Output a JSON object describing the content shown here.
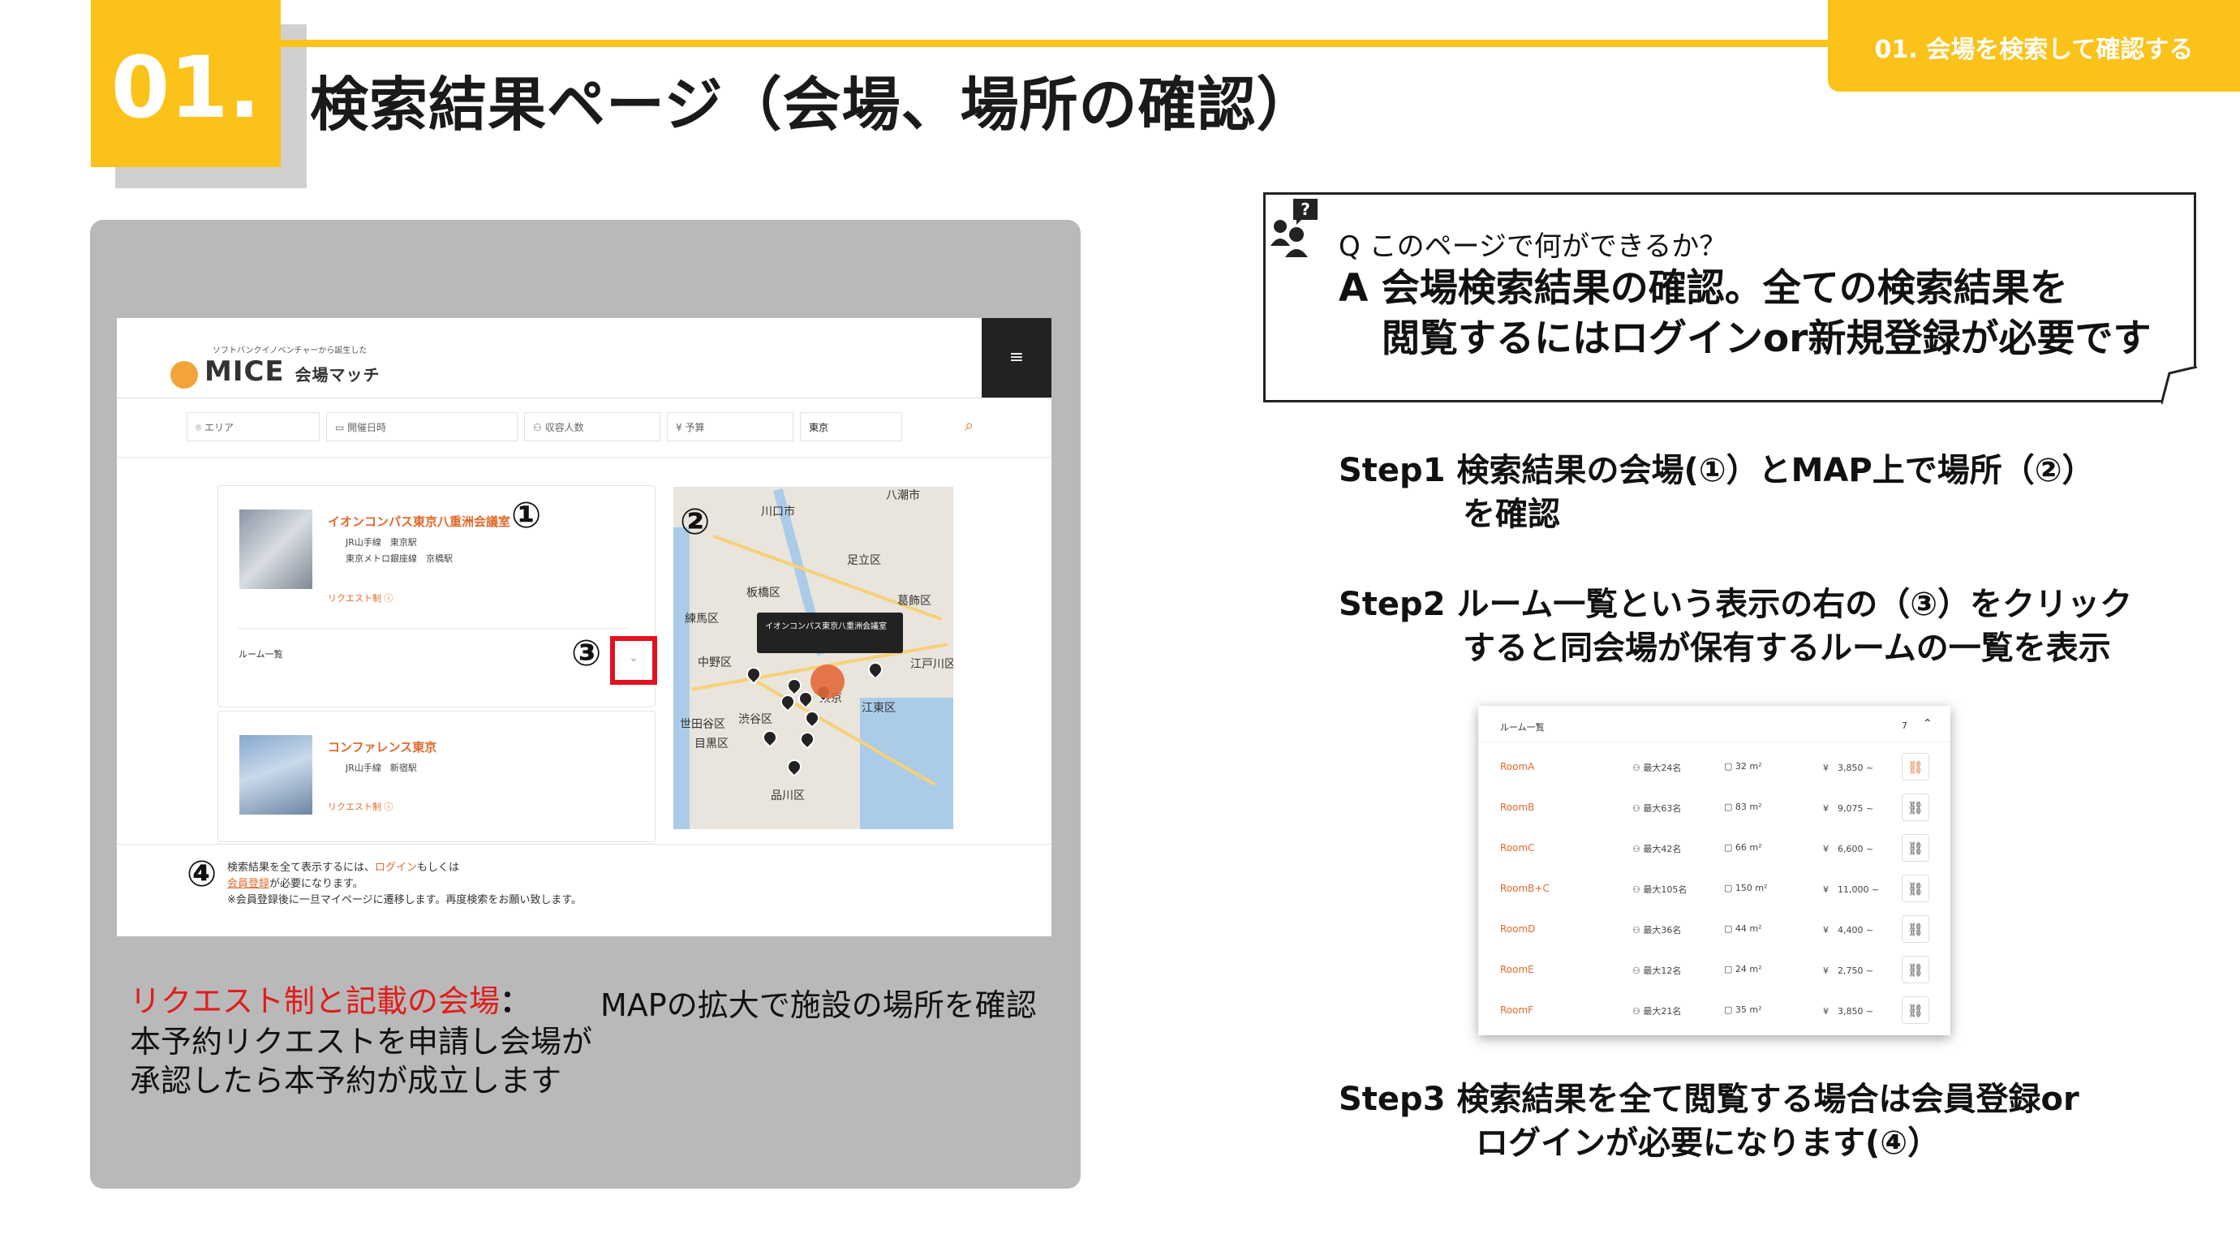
{
  "header": {
    "number": "01.",
    "title": "検索結果ページ（会場、場所の確認）",
    "section_tag": "01. 会場を検索して確認する"
  },
  "screenshot": {
    "logo_tagline": "ソフトバンクイノベンチャーから誕生した",
    "logo_main": "MICE",
    "logo_sub": "会場マッチ",
    "menu_icon": "≡",
    "search_fields": [
      "エリア",
      "開催日時",
      "収容人数",
      "予算",
      "東京"
    ],
    "venues": [
      {
        "name": "イオンコンパス東京八重洲会議室",
        "line1": "JR山手線　東京駅",
        "line2": "東京メトロ銀座線　京橋駅",
        "request": "リクエスト制"
      },
      {
        "name": "コンファレンス東京",
        "line1": "JR山手線　新宿駅",
        "line2": "",
        "request": "リクエスト制"
      }
    ],
    "room_list_label": "ルーム一覧",
    "map_tooltip": "イオンコンパス東京八重洲会議室",
    "map_labels": [
      "川口市",
      "八潮市",
      "足立区",
      "板橋区",
      "葛飾区",
      "練馬区",
      "中野区",
      "江戸川区",
      "江東区",
      "渋谷区",
      "目黒区",
      "世田谷区",
      "品川区",
      "東京"
    ],
    "markers": {
      "m1": "①",
      "m2": "②",
      "m3": "③",
      "m4": "④"
    },
    "notice": {
      "line1_pre": "検索結果を全て表示するには、",
      "line1_link": "ログイン",
      "line1_post": "もしくは",
      "line2_link": "会員登録",
      "line2_post": "が必要になります。",
      "line3": "※会員登録後に一旦マイページに遷移します。再度検索をお願い致します。"
    }
  },
  "captions": {
    "request_title": "リクエスト制と記載の会場",
    "request_colon": "：",
    "request_body1": "本予約リクエストを申請し会場が",
    "request_body2": "承認したら本予約が成立します",
    "map_caption": "MAPの拡大で施設の場所を確認"
  },
  "qa": {
    "q": "Q このページで何ができるか？",
    "a_line1": "A 会場検索結果の確認。全ての検索結果を",
    "a_line2": "閲覧するにはログインor新規登録が必要です"
  },
  "steps": [
    {
      "label": "Step1",
      "line1": "検索結果の会場(①）とMAP上で場所（②）",
      "line2": "を確認"
    },
    {
      "label": "Step2",
      "line1": "ルーム一覧という表示の右の（③）をクリック",
      "line2": "すると同会場が保有するルームの一覧を表示"
    },
    {
      "label": "Step3",
      "line1": "検索結果を全て閲覧する場合は会員登録or",
      "line2": "ログインが必要になります(④）"
    }
  ],
  "room_list": {
    "title": "ルーム一覧",
    "count": "7",
    "rows": [
      {
        "name": "RoomA",
        "capacity": "最大24名",
        "size": "32 m²",
        "price": "¥　3,850 ~"
      },
      {
        "name": "RoomB",
        "capacity": "最大63名",
        "size": "83 m²",
        "price": "¥　9,075 ~"
      },
      {
        "name": "RoomC",
        "capacity": "最大42名",
        "size": "66 m²",
        "price": "¥　6,600 ~"
      },
      {
        "name": "RoomB+C",
        "capacity": "最大105名",
        "size": "150 m²",
        "price": "¥　11,000 ~"
      },
      {
        "name": "RoomD",
        "capacity": "最大36名",
        "size": "44 m²",
        "price": "¥　4,400 ~"
      },
      {
        "name": "RoomE",
        "capacity": "最大12名",
        "size": "24 m²",
        "price": "¥　2,750 ~"
      },
      {
        "name": "RoomF",
        "capacity": "最大21名",
        "size": "35 m²",
        "price": "¥　3,850 ~"
      }
    ]
  },
  "colors": {
    "accent": "#fbc21a",
    "orange": "#e06a2b",
    "red": "#e1121f",
    "panel": "#b9b9b9"
  }
}
